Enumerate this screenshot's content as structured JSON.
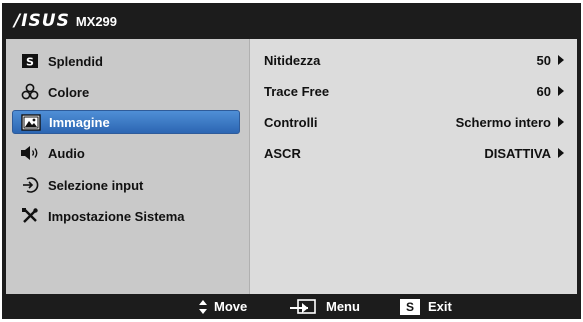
{
  "header": {
    "brand": "/ISUS",
    "model": "MX299"
  },
  "sidebar": {
    "items": [
      {
        "label": "Splendid",
        "icon": "splendid-s-icon"
      },
      {
        "label": "Colore",
        "icon": "color-circles-icon"
      },
      {
        "label": "Immagine",
        "icon": "picture-icon",
        "selected": true
      },
      {
        "label": "Audio",
        "icon": "speaker-icon"
      },
      {
        "label": "Selezione input",
        "icon": "input-arrow-icon"
      },
      {
        "label": "Impostazione Sistema",
        "icon": "tools-icon"
      }
    ]
  },
  "settings": [
    {
      "label": "Nitidezza",
      "value": "50"
    },
    {
      "label": "Trace Free",
      "value": "60"
    },
    {
      "label": "Controlli",
      "value": "Schermo intero"
    },
    {
      "label": "ASCR",
      "value": "DISATTIVA"
    }
  ],
  "footer": {
    "move_label": "Move",
    "menu_label": "Menu",
    "exit_label": "Exit",
    "exit_key": "S"
  },
  "colors": {
    "selected_bg": "#3a78c4",
    "frame_bg": "#1c1c1c",
    "panel_bg": "#d6d6d6"
  }
}
